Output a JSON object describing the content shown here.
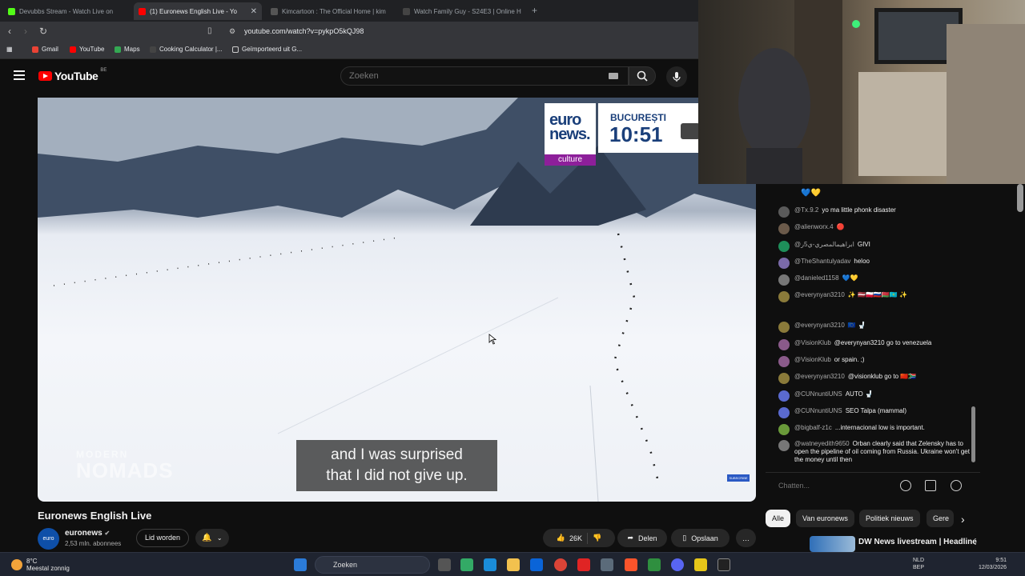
{
  "browser": {
    "tabs": [
      {
        "title": "Devubbs Stream - Watch Live on",
        "color": "#53fc18",
        "active": false
      },
      {
        "title": "(1) Euronews English Live - Yo",
        "color": "#ff0000",
        "active": true
      },
      {
        "title": "Kimcartoon : The Official Home | kim",
        "color": "#555555",
        "active": false
      },
      {
        "title": "Watch Family Guy - S24E3 | Online H",
        "color": "#444444",
        "active": false
      }
    ],
    "new_tab": "+",
    "url": "youtube.com/watch?v=pykpO5kQJ98",
    "bookmarks": [
      "Gmail",
      "YouTube",
      "Maps",
      "Cooking Calculator |...",
      "Geïmporteerd uit G..."
    ]
  },
  "youtube": {
    "logo_text": "YouTube",
    "country": "BE",
    "search_placeholder": "Zoeken"
  },
  "video": {
    "overlay_euro": "euro news.",
    "overlay_culture": "culture",
    "overlay_city": "BUCUREȘTI",
    "overlay_time": "10:51",
    "subtitle_line1": "and I was surprised",
    "subtitle_line2": "that I did not give up.",
    "watermark_line1": "MODERN",
    "watermark_line2": "NOMADS",
    "badge": "SUBSCRIBE"
  },
  "meta": {
    "title": "Euronews English Live",
    "channel": "euronews",
    "channel_avatar": "euro news.",
    "verified": "✔",
    "subscribers": "2,53 mln. abonnees",
    "join_label": "Lid worden",
    "likes": "26K",
    "share_label": "Delen",
    "save_label": "Opslaan",
    "more_label": "…"
  },
  "chat": {
    "top_emoji": "💙💛",
    "messages": [
      {
        "author": "@Tx.9.2",
        "text": "yo ma little phonk disaster",
        "color": "#5a5a5a"
      },
      {
        "author": "@alienworx.4",
        "text": "🔴",
        "color": "#6b5a4a"
      },
      {
        "author": "@ابراهيمالمصري-ي5ر",
        "text": "GIVI",
        "color": "#1e8e5a"
      },
      {
        "author": "@TheShantulyadav",
        "text": "heloo",
        "color": "#7a6aa8"
      },
      {
        "author": "@danieled1158",
        "text": "💙💛",
        "color": "#777777"
      },
      {
        "author": "@everynyan3210",
        "text": "✨ 🇱🇻🇵🇱🇷🇺🇧🇾🇰🇿 ✨",
        "color": "#8a7a3a"
      },
      {
        "author": "@everynyan3210",
        "text": "🇪🇺 🚽",
        "color": "#8a7a3a"
      },
      {
        "author": "@VisionKlub",
        "text": "@everynyan3210 go to venezuela",
        "color": "#8a5a8a"
      },
      {
        "author": "@VisionKlub",
        "text": "or spain. ;)",
        "color": "#8a5a8a"
      },
      {
        "author": "@everynyan3210",
        "text": "@visionklub go to 🇨🇳🇿🇦",
        "color": "#8a7a3a"
      },
      {
        "author": "@CUNnuntiUNS",
        "text": "AUTO 🚽",
        "color": "#5a6acf"
      },
      {
        "author": "@CUNnuntiUNS",
        "text": "SEO Talpa (mammal)",
        "color": "#5a6acf"
      },
      {
        "author": "@bigbalf-z1c",
        "text": "...internacional low is important.",
        "color": "#6a9a3a"
      },
      {
        "author": "@watneyedith9650",
        "text": "Orban clearly said that Zelensky has to open the pipeline of oil coming from Russia. Ukraine won't get the money until then",
        "color": "#777777"
      }
    ],
    "input_placeholder": "Chatten..."
  },
  "chips": [
    "Alle",
    "Van euronews",
    "Politiek nieuws",
    "Gere"
  ],
  "recommendation": {
    "title": "DW News livestream | Headline"
  },
  "taskbar": {
    "temp": "8°C",
    "weather": "Meestal zonnig",
    "search": "Zoeken",
    "lang1": "NLD",
    "lang2": "BEP",
    "time": "9:51",
    "date": "12/03/2026"
  }
}
